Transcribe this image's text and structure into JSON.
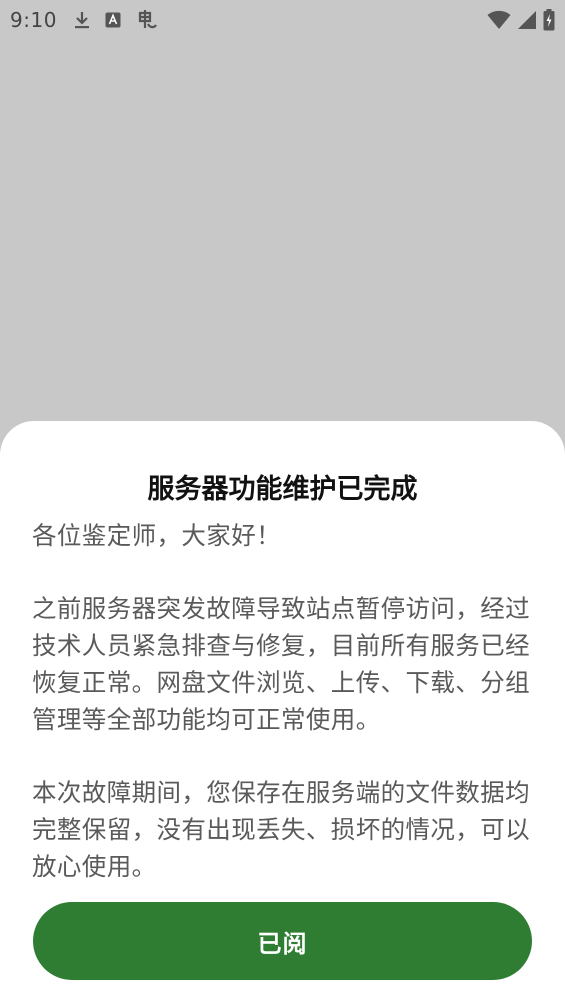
{
  "status_bar": {
    "time": "9:10",
    "left_icons": [
      "download-icon",
      "translate-icon",
      "bug-icon"
    ],
    "right_icons": [
      "wifi-icon",
      "cellular-signal-icon",
      "battery-charging-icon"
    ]
  },
  "dialog": {
    "title": "服务器功能维护已完成",
    "greeting": "各位鉴定师，大家好！",
    "paragraph_1": "之前服务器突发故障导致站点暂停访问，经过技术人员紧急排查与修复，目前所有服务已经恢复正常。网盘文件浏览、上传、下载、分组管理等全部功能均可正常使用。",
    "paragraph_2": "本次故障期间，您保存在服务端的文件数据均完整保留，没有出现丢失、损坏的情况，可以放心使用。",
    "confirm_label": "已阅"
  },
  "colors": {
    "overlay": "#c8c8c8",
    "sheet_background": "#ffffff",
    "button": "#2e7d32",
    "body_text": "#5a5a5a",
    "title_text": "#111111"
  }
}
